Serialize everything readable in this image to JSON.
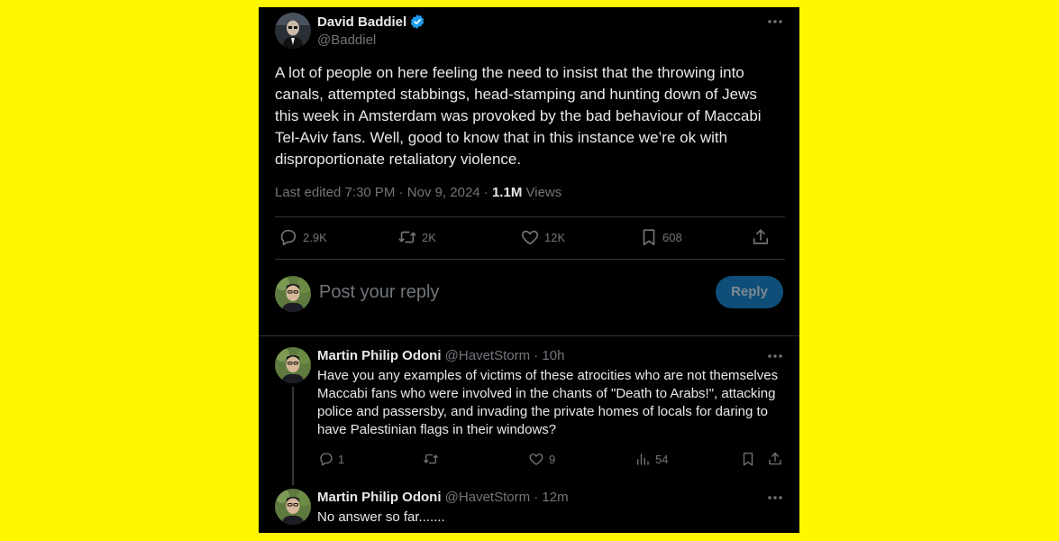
{
  "main_post": {
    "author_name": "David Baddiel",
    "author_handle": "@Baddiel",
    "text": "A lot of people on here feeling the need to insist that the throwing into canals, attempted stabbings, head-stamping and hunting down of Jews this week in Amsterdam was provoked by the bad behaviour of Maccabi Tel-Aviv fans. Well, good to know that in this instance we’re ok with disproportionate retaliatory violence.",
    "meta_prefix": "Last edited 7:30 PM · Nov 9, 2024 · ",
    "views_count": "1.1M",
    "views_label": "Views",
    "actions": {
      "replies": "2.9K",
      "reposts": "2K",
      "likes": "12K",
      "bookmarks": "608"
    }
  },
  "reply_box": {
    "placeholder": "Post your reply",
    "button_label": "Reply"
  },
  "replies": [
    {
      "author_name": "Martin Philip Odoni",
      "author_handle": "@HavetStorm",
      "time": "· 10h",
      "text": "Have you any examples of victims of these atrocities who are not themselves Maccabi fans who were involved in the chants of \"Death to Arabs!\", attacking police and passersby, and invading the private homes of locals for daring to have Palestinian flags in their windows?",
      "actions": {
        "replies": "1",
        "reposts": "",
        "likes": "9",
        "views": "54"
      }
    },
    {
      "author_name": "Martin Philip Odoni",
      "author_handle": "@HavetStorm",
      "time": "· 12m",
      "text": "No answer so far......."
    }
  ],
  "colors": {
    "background": "#FFF700",
    "panel": "#000000",
    "text": "#E7E9EA",
    "muted": "#71767B",
    "verified": "#1D9BF0",
    "reply_button": "#0F4E78"
  },
  "icons": [
    "verified-badge-icon",
    "more-icon",
    "reply-icon",
    "repost-icon",
    "like-icon",
    "bookmark-icon",
    "share-icon",
    "views-icon"
  ]
}
